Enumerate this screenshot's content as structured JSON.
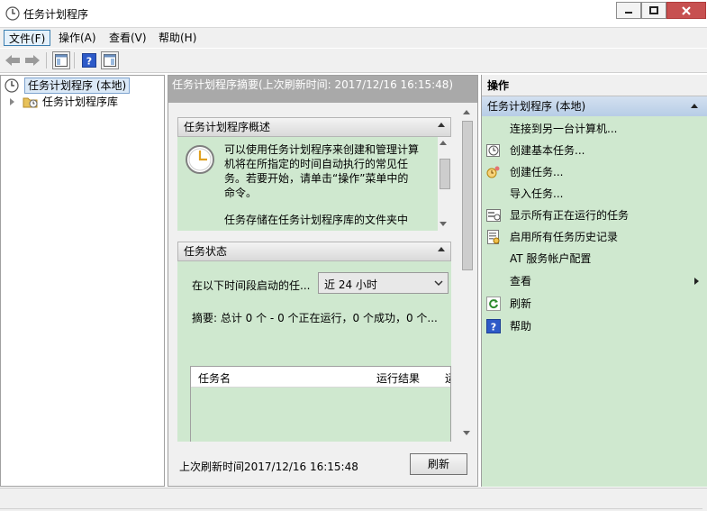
{
  "window": {
    "title": "任务计划程序"
  },
  "menu": {
    "file": "文件(F)",
    "action": "操作(A)",
    "view": "查看(V)",
    "help": "帮助(H)"
  },
  "tree": {
    "root": "任务计划程序 (本地)",
    "child": "任务计划程序库"
  },
  "center": {
    "header": "任务计划程序摘要(上次刷新时间: 2017/12/16 16:15:48)",
    "overview": {
      "title": "任务计划程序概述",
      "line1": "可以使用任务计划程序来创建和管理计算",
      "line2": "机将在所指定的时间自动执行的常见任",
      "line3": "务。若要开始，请单击“操作”菜单中的",
      "line4": "命令。",
      "line5": "任务存储在任务计划程序库的文件夹中"
    },
    "status": {
      "title": "任务状态",
      "range_label": "在以下时间段启动的任...",
      "range_value": "近 24 小时",
      "summary": "摘要: 总计 0 个 - 0 个正在运行，0 个成功，0 个...",
      "columns": [
        "任务名",
        "运行结果",
        "运"
      ]
    },
    "footer": {
      "last_refresh": "上次刷新时间2017/12/16 16:15:48",
      "refresh_button": "刷新"
    }
  },
  "actions": {
    "title": "操作",
    "group": "任务计划程序 (本地)",
    "items": [
      {
        "label": "连接到另一台计算机...",
        "icon": ""
      },
      {
        "label": "创建基本任务...",
        "icon": "clock-icon"
      },
      {
        "label": "创建任务...",
        "icon": "task-icon"
      },
      {
        "label": "导入任务...",
        "icon": ""
      },
      {
        "label": "显示所有正在运行的任务",
        "icon": "running-tasks-icon"
      },
      {
        "label": "启用所有任务历史记录",
        "icon": "history-icon"
      },
      {
        "label": "AT 服务帐户配置",
        "icon": ""
      },
      {
        "label": "查看",
        "icon": ""
      },
      {
        "label": "刷新",
        "icon": "refresh-icon"
      },
      {
        "label": "帮助",
        "icon": "help-icon"
      }
    ]
  },
  "colors": {
    "accent": "#3c7fb1",
    "close": "#c75050",
    "panel_green": "#cfe8cf"
  }
}
